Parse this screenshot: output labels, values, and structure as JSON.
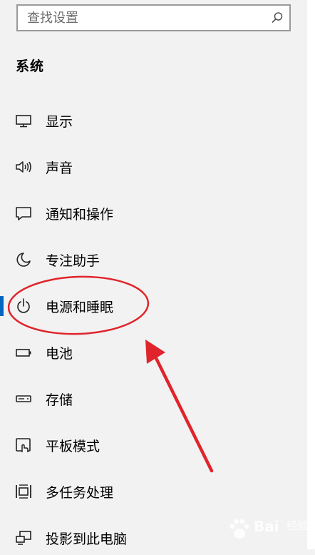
{
  "search": {
    "placeholder": "查找设置"
  },
  "section_title": "系统",
  "nav_items": [
    {
      "label": "显示"
    },
    {
      "label": "声音"
    },
    {
      "label": "通知和操作"
    },
    {
      "label": "专注助手"
    },
    {
      "label": "电源和睡眠"
    },
    {
      "label": "电池"
    },
    {
      "label": "存储"
    },
    {
      "label": "平板模式"
    },
    {
      "label": "多任务处理"
    },
    {
      "label": "投影到此电脑"
    }
  ],
  "selected_index": 4,
  "colors": {
    "accent": "#0067c0",
    "annotation": "#e0242b",
    "background": "#f2f2f2"
  },
  "watermark": {
    "text": "Bai",
    "sub": "经验"
  }
}
